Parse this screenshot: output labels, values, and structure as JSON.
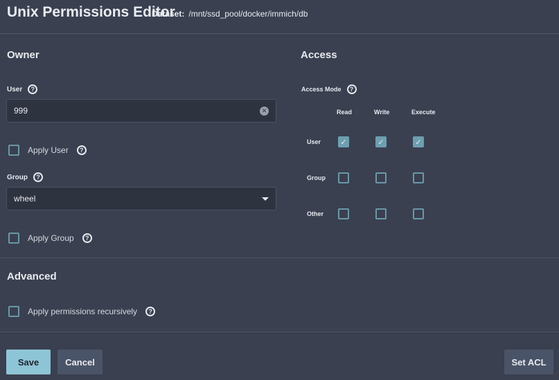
{
  "header": {
    "title": "Unix Permissions Editor",
    "dataset_label": "Dataset:",
    "dataset_path": "/mnt/ssd_pool/docker/immich/db"
  },
  "owner": {
    "heading": "Owner",
    "user_label": "User",
    "user_value": "999",
    "apply_user": "Apply User",
    "apply_user_checked": false,
    "group_label": "Group",
    "group_value": "wheel",
    "apply_group": "Apply Group",
    "apply_group_checked": false
  },
  "access": {
    "heading": "Access",
    "mode_label": "Access Mode",
    "columns": [
      "Read",
      "Write",
      "Execute"
    ],
    "rows": [
      {
        "label": "User",
        "values": [
          true,
          true,
          true
        ]
      },
      {
        "label": "Group",
        "values": [
          false,
          false,
          false
        ]
      },
      {
        "label": "Other",
        "values": [
          false,
          false,
          false
        ]
      }
    ]
  },
  "advanced": {
    "heading": "Advanced",
    "recursive": "Apply permissions recursively",
    "recursive_checked": false
  },
  "buttons": {
    "save": "Save",
    "cancel": "Cancel",
    "set_acl": "Set ACL"
  },
  "colors": {
    "accent": "#8ec5d6",
    "checkbox": "#6d9fb0",
    "background": "#3a4050"
  }
}
